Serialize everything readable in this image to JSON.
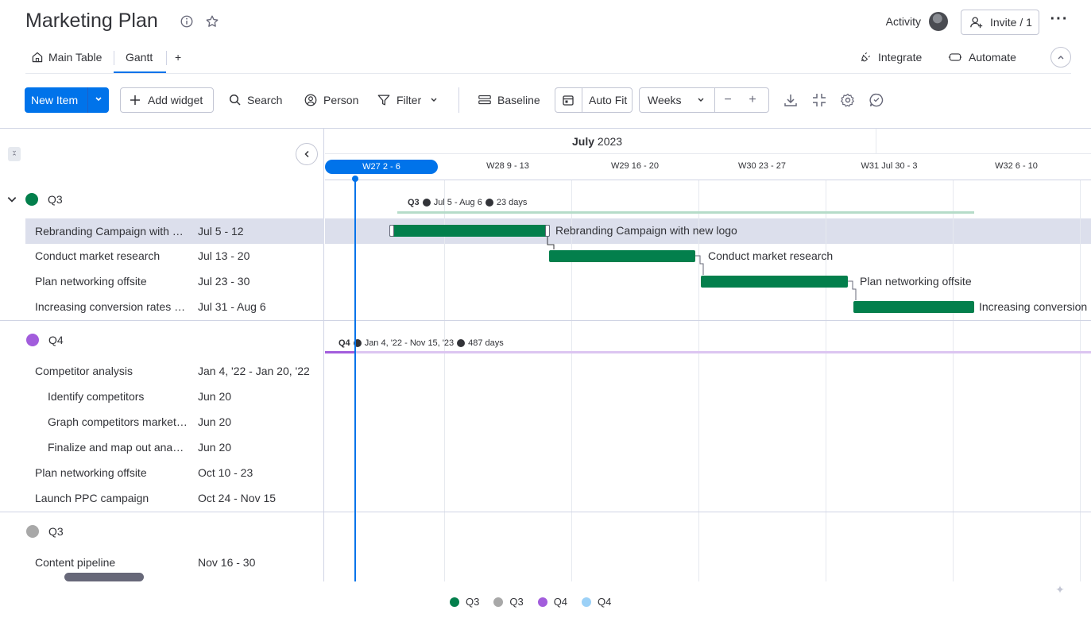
{
  "header": {
    "title": "Marketing Plan",
    "activity_label": "Activity",
    "invite_label": "Invite / 1"
  },
  "tabs": {
    "items": [
      {
        "label": "Main Table"
      },
      {
        "label": "Gantt"
      }
    ],
    "add_label": "+",
    "integrate_label": "Integrate",
    "automate_label": "Automate"
  },
  "toolbar": {
    "new_item_label": "New Item",
    "add_widget_label": "Add widget",
    "search_label": "Search",
    "person_label": "Person",
    "filter_label": "Filter",
    "baseline_label": "Baseline",
    "auto_fit_label": "Auto Fit",
    "scale_value": "Weeks"
  },
  "timeline": {
    "month_strong": "July",
    "month_year": "2023",
    "weeks": [
      "W27 2 - 6",
      "W28 9 - 13",
      "W29 16 - 20",
      "W30 23 - 27",
      "W31 Jul 30 - 3",
      "W32 6 - 10"
    ]
  },
  "groups": [
    {
      "name": "Q3",
      "color": "#037f4c",
      "summary_dates": "Jul 5 - Aug 6",
      "summary_days": "23 days",
      "items": [
        {
          "name": "Rebranding Campaign with new logo",
          "dates": "Jul 5 - 12",
          "bar_label": "Rebranding Campaign with new logo"
        },
        {
          "name": "Conduct market research",
          "dates": "Jul 13 - 20",
          "bar_label": "Conduct market research"
        },
        {
          "name": "Plan networking offsite",
          "dates": "Jul 23 - 30",
          "bar_label": "Plan networking offsite"
        },
        {
          "name": "Increasing conversion rates on landing page",
          "dates": "Jul 31 - Aug 6",
          "bar_label": "Increasing conversion"
        }
      ]
    },
    {
      "name": "Q4",
      "color": "#a25ddc",
      "summary_dates": "Jan 4, '22 - Nov 15, '23",
      "summary_days": "487 days",
      "items": [
        {
          "name": "Competitor analysis",
          "dates": "Jan 4, '22 - Jan 20, '22"
        },
        {
          "name": "Identify competitors",
          "dates": "Jun 20"
        },
        {
          "name": "Graph competitors marketing strategies",
          "dates": "Jun 20"
        },
        {
          "name": "Finalize and map out anaylsis",
          "dates": "Jun 20"
        },
        {
          "name": "Plan networking offsite",
          "dates": "Oct 10 - 23"
        },
        {
          "name": "Launch PPC campaign",
          "dates": "Oct 24 - Nov 15"
        }
      ]
    },
    {
      "name": "Q3",
      "color": "#a8a8a8",
      "items": [
        {
          "name": "Content pipeline",
          "dates": "Nov 16 - 30"
        }
      ]
    }
  ],
  "legend": [
    {
      "label": "Q3",
      "color": "#037f4c"
    },
    {
      "label": "Q3",
      "color": "#a8a8a8"
    },
    {
      "label": "Q4",
      "color": "#a25ddc"
    },
    {
      "label": "Q4",
      "color": "#9cd1f7"
    }
  ]
}
